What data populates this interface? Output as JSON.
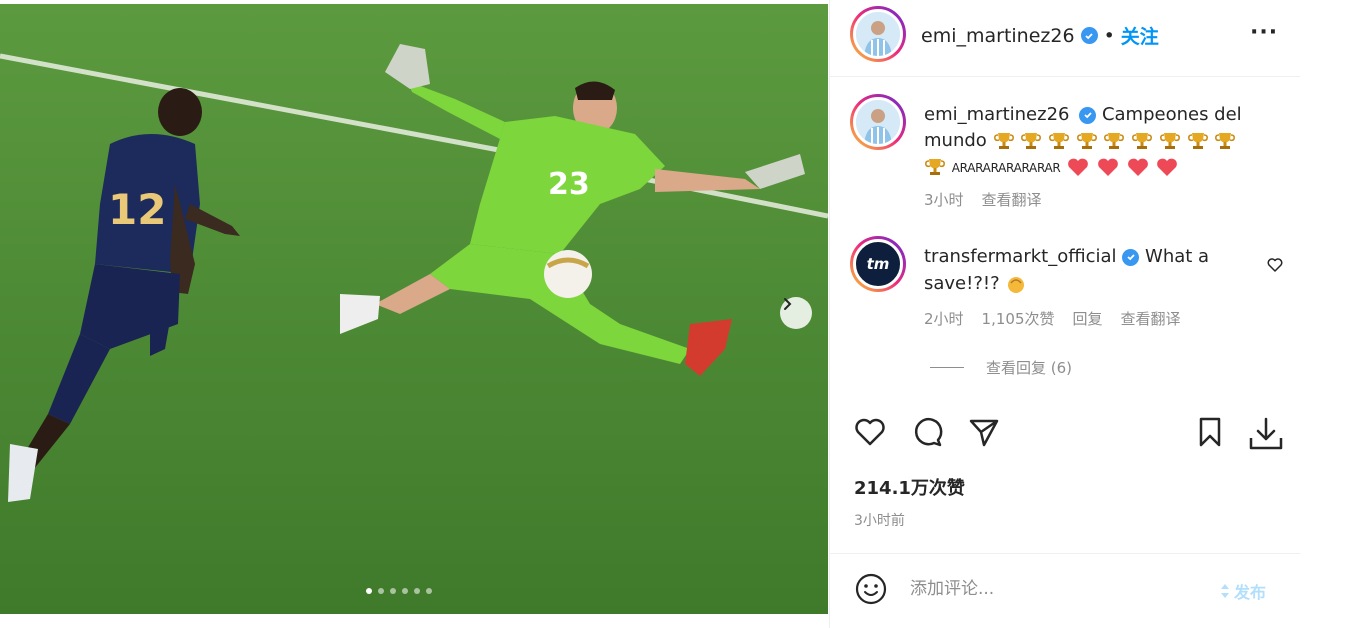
{
  "post": {
    "image_alt": "Goalkeeper in green diving to save against a player in navy",
    "kit_number_keeper": "23",
    "kit_number_striker": "12",
    "carousel_count": 6,
    "carousel_active": 0
  },
  "header": {
    "username": "emi_martinez26",
    "separator": "•",
    "follow_label": "关注",
    "more_label": "···"
  },
  "caption": {
    "username": "emi_martinez26",
    "text": "Campeones del mundo",
    "emoji_trophy_count": 10,
    "tail_text": "ARARARARARARAR",
    "emoji_heart_count": 4,
    "time": "3小时",
    "translate_label": "查看翻译"
  },
  "comment": {
    "username": "transfermarkt_official",
    "avatar_text": "tm",
    "text": "What a save!?!?",
    "time": "2小时",
    "likes": "1,105次赞",
    "reply_label": "回复",
    "translate_label": "查看翻译",
    "view_replies_label": "查看回复 (6)"
  },
  "stats": {
    "likes": "214.1万次赞",
    "time_ago": "3小时前"
  },
  "composer": {
    "placeholder": "添加评论...",
    "post_label": "发布"
  },
  "colors": {
    "accent": "#0095f6",
    "heart": "#ed4956",
    "verified": "#3897f0"
  }
}
